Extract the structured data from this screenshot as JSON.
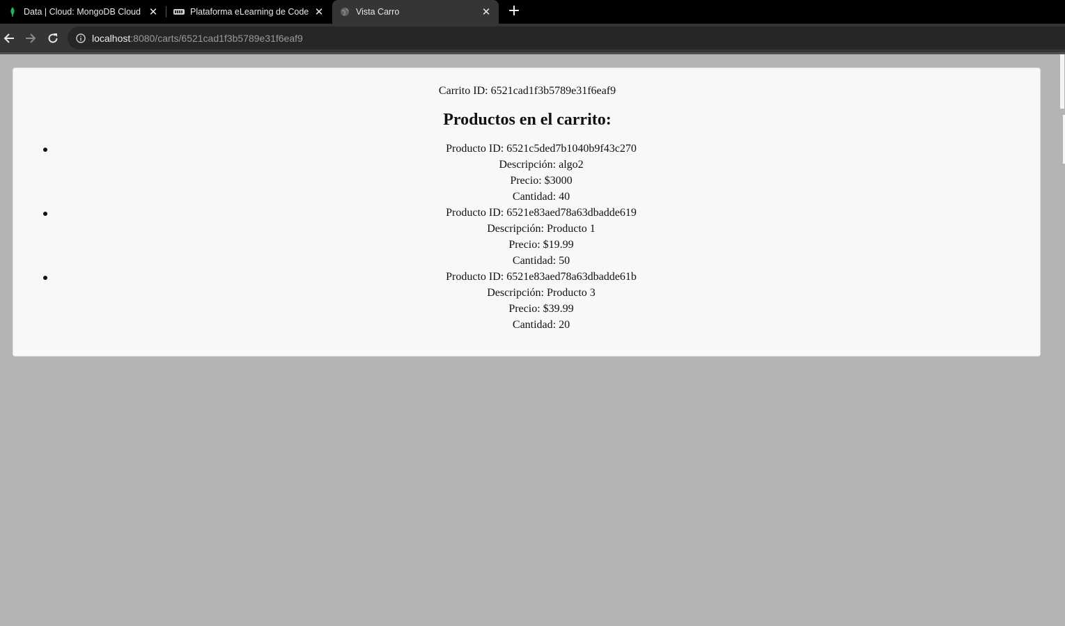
{
  "browser": {
    "tabs": [
      {
        "title": "Data | Cloud: MongoDB Cloud",
        "icon": "mongodb-leaf-icon",
        "active": false
      },
      {
        "title": "Plataforma eLearning de Coderhouse",
        "icon": "coderhouse-icon",
        "active": false
      },
      {
        "title": "Vista Carro",
        "icon": "globe-icon",
        "active": true
      }
    ],
    "address": {
      "host": "localhost",
      "path": ":8080/carts/6521cad1f3b5789e31f6eaf9"
    }
  },
  "page": {
    "cart_id_text": "Carrito ID: 6521cad1f3b5789e31f6eaf9",
    "heading": "Productos en el carrito:",
    "products": [
      {
        "id": "Producto ID: 6521c5ded7b1040b9f43c270",
        "desc": "Descripción: algo2",
        "price": "Precio: $3000",
        "qty": "Cantidad: 40"
      },
      {
        "id": "Producto ID: 6521e83aed78a63dbadde619",
        "desc": "Descripción: Producto 1",
        "price": "Precio: $19.99",
        "qty": "Cantidad: 50"
      },
      {
        "id": "Producto ID: 6521e83aed78a63dbadde61b",
        "desc": "Descripción: Producto 3",
        "price": "Precio: $39.99",
        "qty": "Cantidad: 20"
      }
    ]
  },
  "colors": {
    "page_background": "#b4b4b2",
    "card_background": "#f8f8f8",
    "tabstrip": "#000000",
    "toolbar": "#353535"
  }
}
